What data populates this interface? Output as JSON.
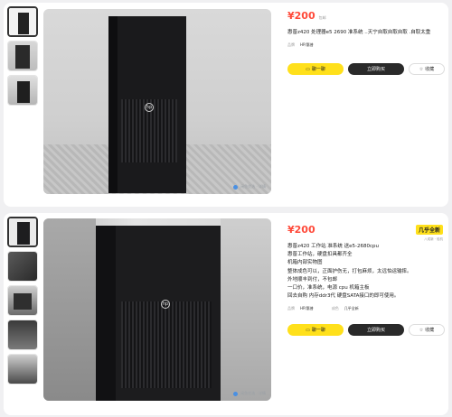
{
  "listing1": {
    "price": "¥200",
    "price_note": "包邮",
    "title": "惠普z420 处理器e5 2690 准系统 ..天宁自取自取自取 .自取太重",
    "meta": {
      "brand_label": "品牌",
      "brand_value": "HP/惠普"
    },
    "buttons": {
      "chat": "聊一聊",
      "buy": "立即购买",
      "favorite": "收藏"
    },
    "watermark": "闲鱼优选 · 详情"
  },
  "listing2": {
    "price": "¥200",
    "condition_badge": "几乎全新",
    "condition_sub": "八成新 · 验机",
    "desc_lines": [
      "惠普z420 工作站 准系统 送e5-2680cpu",
      "惠普工作站，硬盘扣具都齐全",
      "机箱内部实物图",
      "整体成色可以，正面护伤无，打包麻烦，太远怕运输摔。",
      "外地顺丰到付，不包邮",
      "一口价，准系统，电源 cpu 机箱主板",
      "回去自购 内存ddr3代 硬盘SATA接口的即可使用。"
    ],
    "meta": {
      "brand_label": "品牌",
      "brand_value": "HP/惠普",
      "cond_label": "成色",
      "cond_value": "几乎全新"
    },
    "buttons": {
      "chat": "聊一聊",
      "buy": "立即购买",
      "favorite": "收藏"
    },
    "watermark": "闲鱼优选 · 详情"
  },
  "icons": [
    "chat-bubble-icon",
    "star-icon"
  ],
  "colors": {
    "price": "#ff4a3a",
    "accent": "#ffe01b",
    "dark_button": "#2a2a2a"
  }
}
